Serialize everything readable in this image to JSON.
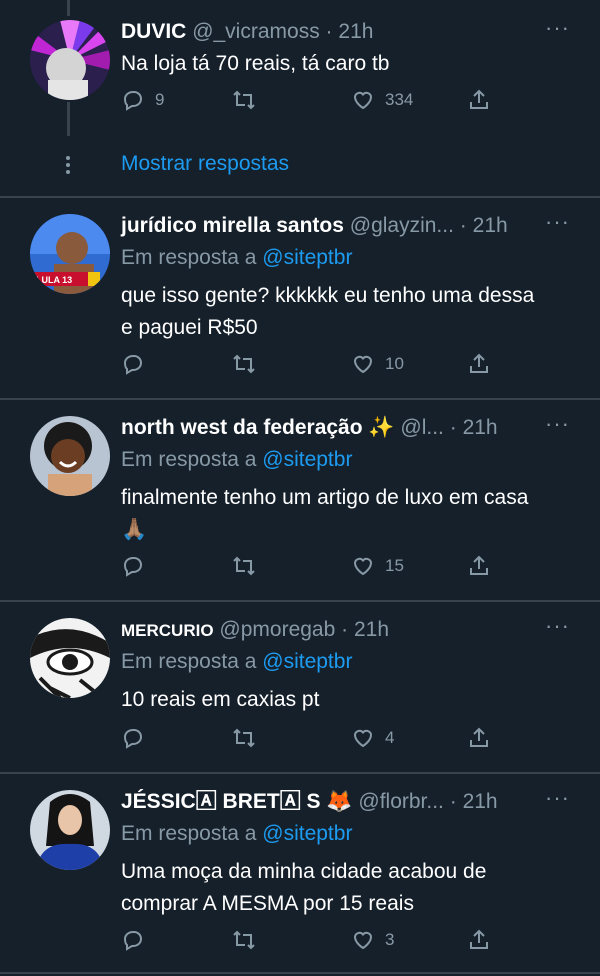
{
  "tweets": [
    {
      "name": "DUVIC",
      "handle": "@_vicramoss",
      "time": "21h",
      "reply_prefix": "",
      "reply_handle": "",
      "text": "Na loja tá 70 reais, tá caro tb",
      "replies": "9",
      "retweets": "",
      "likes": "334"
    },
    {
      "name": "jurídico mirella santos",
      "handle": "@glayzin...",
      "time": "21h",
      "reply_prefix": "Em resposta a",
      "reply_handle": "@siteptbr",
      "text": "que isso gente? kkkkkk eu tenho uma dessa e paguei R$50",
      "replies": "",
      "retweets": "",
      "likes": "10",
      "avatar_badge": "LULA 13"
    },
    {
      "name": "north west da federação ✨",
      "handle": "@l...",
      "time": "21h",
      "reply_prefix": "Em resposta a",
      "reply_handle": "@siteptbr",
      "text": "finalmente tenho um artigo de luxo em casa 🙏🏽",
      "replies": "",
      "retweets": "",
      "likes": "15"
    },
    {
      "name": "MERCURIO",
      "handle": "@pmoregab",
      "time": "21h",
      "reply_prefix": "Em resposta a",
      "reply_handle": "@siteptbr",
      "text": "10 reais em caxias pt",
      "replies": "",
      "retweets": "",
      "likes": "4"
    },
    {
      "name": "JÉSSIC🄰 BRET🄰 S 🦊",
      "handle": "@florbr...",
      "time": "21h",
      "reply_prefix": "Em resposta a",
      "reply_handle": "@siteptbr",
      "text": "Uma moça da minha cidade acabou de comprar A MESMA por 15 reais",
      "replies": "",
      "retweets": "",
      "likes": "3"
    }
  ],
  "show_replies": "Mostrar respostas",
  "icons": {
    "reply": "reply-icon",
    "retweet": "retweet-icon",
    "like": "heart-icon",
    "share": "share-icon",
    "more": "more-icon"
  },
  "colors": {
    "background": "#15202b",
    "muted": "#8899a6",
    "link": "#1d9bf0",
    "divider": "#38444d"
  }
}
